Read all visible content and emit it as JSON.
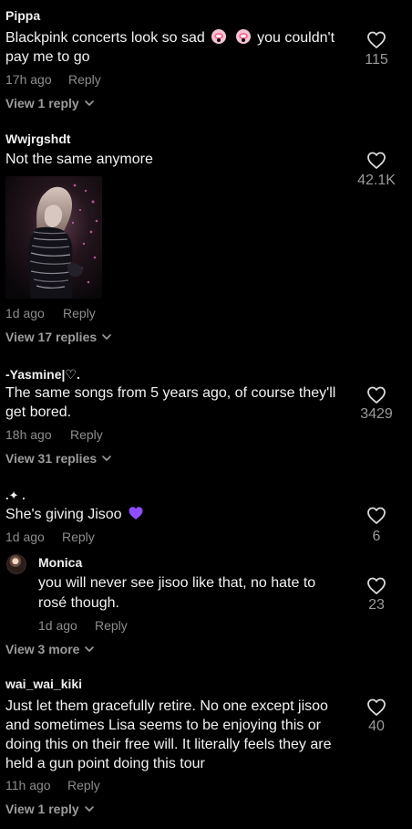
{
  "comments": [
    {
      "username": "Pippa",
      "text_line_1_a": "Blackpink concerts look so sad",
      "text_line_1_b": "you couldn't",
      "text_line_2": "pay me to go",
      "time": "17h ago",
      "reply_label": "Reply",
      "likes": "115",
      "view_replies_label": "View 1 reply"
    },
    {
      "username": "Wwjrgshdt",
      "text": "Not the same anymore",
      "time": "1d ago",
      "reply_label": "Reply",
      "likes": "42.1K",
      "view_replies_label": "View 17 replies"
    },
    {
      "username": "-Yasmine|♡.",
      "text_line_1": "The same songs from 5 years ago, of course they'll",
      "text_line_2": "get bored.",
      "time": "18h ago",
      "reply_label": "Reply",
      "likes": "3429",
      "view_replies_label": "View 31 replies"
    },
    {
      "username": ".✦ .",
      "text": "She's giving Jisoo",
      "time": "1d ago",
      "reply_label": "Reply",
      "likes": "6"
    },
    {
      "username": "wai_wai_kiki",
      "text_line_1": "Just let them gracefully retire. No one except jisoo",
      "text_line_2": "and sometimes Lisa seems to be enjoying this or",
      "text_line_3": "doing this on their free will. It literally feels they are",
      "text_line_4": "held a gun point doing this tour",
      "time": "11h ago",
      "reply_label": "Reply",
      "likes": "40",
      "view_replies_label": "View 1 reply"
    }
  ],
  "reply": {
    "username": "Monica",
    "text_line_1": "you will never see jisoo like that, no hate to",
    "text_line_2": "rosé though.",
    "time": "1d ago",
    "reply_label": "Reply",
    "likes": "23"
  },
  "view_more_label": "View 3 more",
  "icons": {
    "heart": "heart-outline-icon",
    "chevron": "chevron-down-icon",
    "emoji": "screaming-face-emoji",
    "purple_heart": "purple-heart-emoji"
  },
  "colors": {
    "background": "#000000",
    "primary_text": "#f2f2f2",
    "secondary_text": "#8d8d8d",
    "purple_heart": "#8f4dff"
  }
}
